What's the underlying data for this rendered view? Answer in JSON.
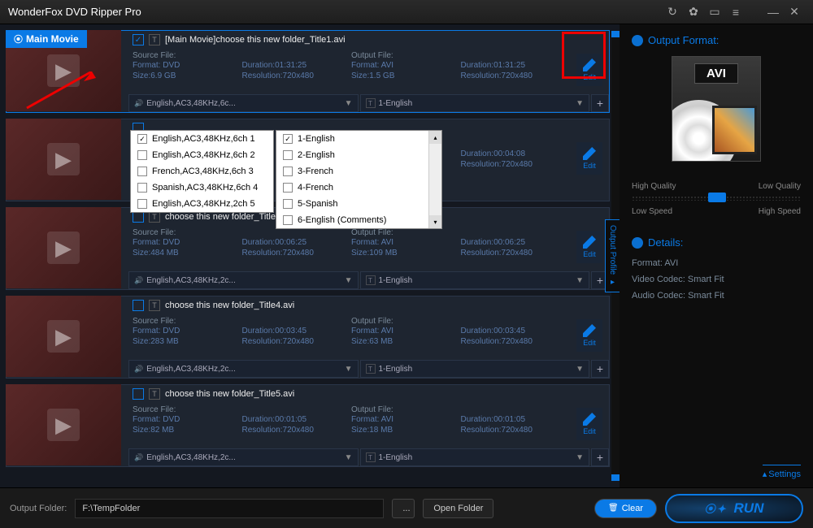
{
  "app": {
    "title": "WonderFox DVD Ripper Pro"
  },
  "main_badge": "Main Movie",
  "items": [
    {
      "title": "[Main Movie]choose this new folder_Title1.avi",
      "checked": true,
      "src_label": "Source File:",
      "src_format": "Format: DVD",
      "src_size": "Size:6.9 GB",
      "duration": "Duration:01:31:25",
      "resolution": "Resolution:720x480",
      "out_label": "Output File:",
      "out_format": "Format: AVI",
      "out_size": "Size:1.5 GB",
      "out_duration": "Duration:01:31:25",
      "out_resolution": "Resolution:720x480",
      "edit": "Edit",
      "audio": "English,AC3,48KHz,6c...",
      "sub": "1-English"
    },
    {
      "title": "",
      "src_format": "",
      "src_size": "",
      "out_duration": "Duration:00:04:08",
      "out_resolution": "Resolution:720x480",
      "edit": "Edit"
    },
    {
      "title": "choose this new folder_Title3.avi",
      "src_label": "Source File:",
      "src_format": "Format: DVD",
      "src_size": "Size:484 MB",
      "duration": "Duration:00:06:25",
      "resolution": "Resolution:720x480",
      "out_label": "Output File:",
      "out_format": "Format: AVI",
      "out_size": "Size:109 MB",
      "out_duration": "Duration:00:06:25",
      "out_resolution": "Resolution:720x480",
      "edit": "Edit",
      "audio": "English,AC3,48KHz,2c...",
      "sub": "1-English"
    },
    {
      "title": "choose this new folder_Title4.avi",
      "src_label": "Source File:",
      "src_format": "Format: DVD",
      "src_size": "Size:283 MB",
      "duration": "Duration:00:03:45",
      "resolution": "Resolution:720x480",
      "out_label": "Output File:",
      "out_format": "Format: AVI",
      "out_size": "Size:63 MB",
      "out_duration": "Duration:00:03:45",
      "out_resolution": "Resolution:720x480",
      "edit": "Edit",
      "audio": "English,AC3,48KHz,2c...",
      "sub": "1-English"
    },
    {
      "title": "choose this new folder_Title5.avi",
      "src_label": "Source File:",
      "src_format": "Format: DVD",
      "src_size": "Size:82 MB",
      "duration": "Duration:00:01:05",
      "resolution": "Resolution:720x480",
      "out_label": "Output File:",
      "out_format": "Format: AVI",
      "out_size": "Size:18 MB",
      "out_duration": "Duration:00:01:05",
      "out_resolution": "Resolution:720x480",
      "edit": "Edit",
      "audio": "English,AC3,48KHz,2c...",
      "sub": "1-English"
    }
  ],
  "audio_menu": [
    {
      "label": "English,AC3,48KHz,6ch 1",
      "checked": true
    },
    {
      "label": "English,AC3,48KHz,6ch 2",
      "checked": false
    },
    {
      "label": "French,AC3,48KHz,6ch 3",
      "checked": false
    },
    {
      "label": "Spanish,AC3,48KHz,6ch 4",
      "checked": false
    },
    {
      "label": "English,AC3,48KHz,2ch 5",
      "checked": false
    }
  ],
  "sub_menu": [
    {
      "label": "1-English",
      "checked": true
    },
    {
      "label": "2-English",
      "checked": false
    },
    {
      "label": "3-French",
      "checked": false
    },
    {
      "label": "4-French",
      "checked": false
    },
    {
      "label": "5-Spanish",
      "checked": false
    },
    {
      "label": "6-English (Comments)",
      "checked": false
    }
  ],
  "right": {
    "profile_tab": "Output Profile",
    "output_format_h": "Output Format:",
    "format": "AVI",
    "hq": "High Quality",
    "lq": "Low Quality",
    "ls": "Low Speed",
    "hs": "High Speed",
    "details_h": "Details:",
    "d_format": "Format: AVI",
    "d_vcodec": "Video Codec: Smart Fit",
    "d_acodec": "Audio Codec: Smart Fit",
    "settings": "Settings"
  },
  "bottom": {
    "folder_label": "Output Folder:",
    "folder_value": "F:\\TempFolder",
    "browse": "...",
    "open": "Open Folder",
    "clear": "Clear",
    "run": "RUN"
  }
}
